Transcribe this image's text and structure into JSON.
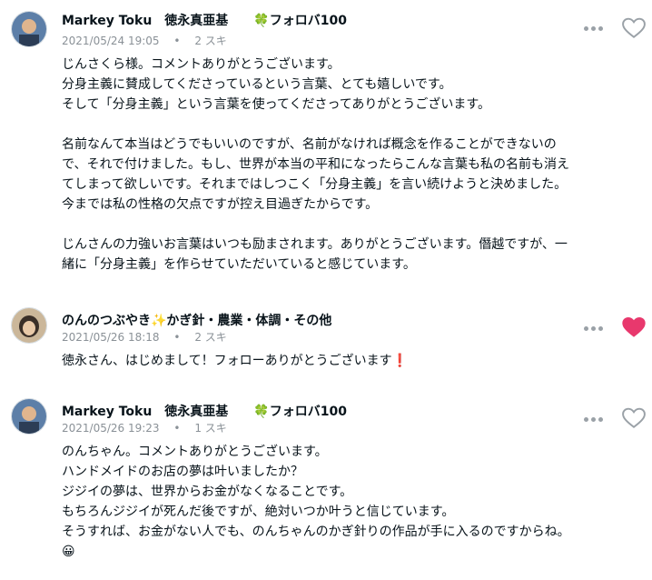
{
  "comments": [
    {
      "author": "Markey Toku　徳永真亜基　　🍀フォロバ100",
      "date": "2021/05/24 19:05",
      "likes": "2 スキ",
      "liked": false,
      "lines": [
        "じんさくら様。コメントありがとうございます。",
        "分身主義に賛成してくださっているという言葉、とても嬉しいです。",
        "そして「分身主義」という言葉を使ってくださってありがとうございます。",
        "",
        "名前なんて本当はどうでもいいのですが、名前がなければ概念を作ることができないの",
        "で、それで付けました。もし、世界が本当の平和になったらこんな言葉も私の名前も消え",
        "てしまって欲しいです。それまではしつこく「分身主義」を言い続けようと決めました。",
        "今までは私の性格の欠点ですが控え目過ぎたからです。",
        "",
        "じんさんの力強いお言葉はいつも励まされます。ありがとうございます。僭越ですが、一",
        "緒に「分身主義」を作らせていただいていると感じています。"
      ]
    },
    {
      "author": "のんのつぶやき✨かぎ針・農業・体調・その他",
      "date": "2021/05/26 18:18",
      "likes": "2 スキ",
      "liked": true,
      "lines": [
        "徳永さん、はじめまして！フォローありがとうございます❗"
      ]
    },
    {
      "author": "Markey Toku　徳永真亜基　　🍀フォロバ100",
      "date": "2021/05/26 19:23",
      "likes": "1 スキ",
      "liked": false,
      "lines": [
        "のんちゃん。コメントありがとうございます。",
        "ハンドメイドのお店の夢は叶いましたか？",
        "ジジイの夢は、世界からお金がなくなることです。",
        "もちろんジジイが死んだ後ですが、絶対いつか叶うと信じています。",
        "そうすれば、お金がない人でも、のんちゃんのかぎ針りの作品が手に入るのですからね。",
        "😀"
      ]
    }
  ],
  "colors": {
    "heart_liked": "#e8386d",
    "heart_outline": "#9aa1a7",
    "meta": "#8a9197"
  },
  "icons": {
    "more": "more-dots-icon",
    "like": "heart-icon"
  }
}
